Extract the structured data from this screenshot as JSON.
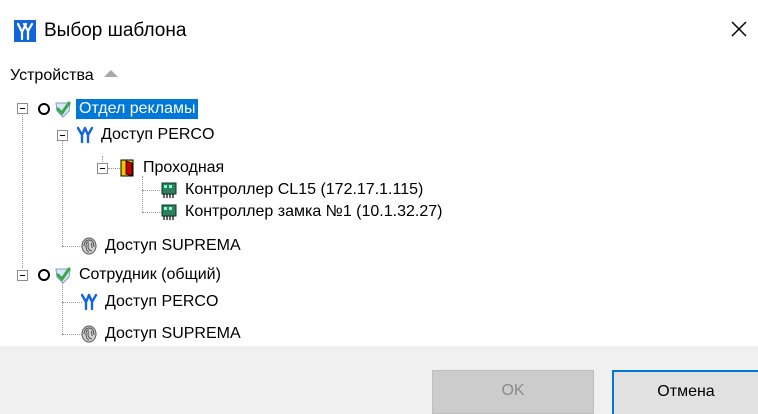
{
  "window": {
    "title": "Выбор шаблона",
    "close_icon": "close-icon"
  },
  "tree": {
    "column_header": "Устройства",
    "sort": "ascending",
    "nodes": [
      {
        "label": "Отдел рекламы",
        "icon": "checkmark-shield-icon",
        "selected": true,
        "children": [
          {
            "label": "Доступ PERCO",
            "icon": "perco-logo-icon",
            "children": [
              {
                "label": "Проходная",
                "icon": "door-icon",
                "children": [
                  {
                    "label": "Контроллер CL15 (172.17.1.115)",
                    "icon": "controller-icon"
                  },
                  {
                    "label": "Контроллер замка №1 (10.1.32.27)",
                    "icon": "controller-icon"
                  }
                ]
              }
            ]
          },
          {
            "label": "Доступ SUPREMA",
            "icon": "fingerprint-icon"
          }
        ]
      },
      {
        "label": "Сотрудник (общий)",
        "icon": "checkmark-shield-icon",
        "children": [
          {
            "label": "Доступ PERCO",
            "icon": "perco-logo-icon"
          },
          {
            "label": "Доступ SUPREMA",
            "icon": "fingerprint-icon"
          }
        ]
      }
    ]
  },
  "buttons": {
    "ok": {
      "label": "OK",
      "enabled": false
    },
    "cancel": {
      "label": "Отмена",
      "enabled": true
    }
  },
  "colors": {
    "selection": "#0078d7",
    "perco_blue": "#1464dc",
    "check_green": "#3aa84a",
    "footer_bg": "#f0f0f0"
  }
}
